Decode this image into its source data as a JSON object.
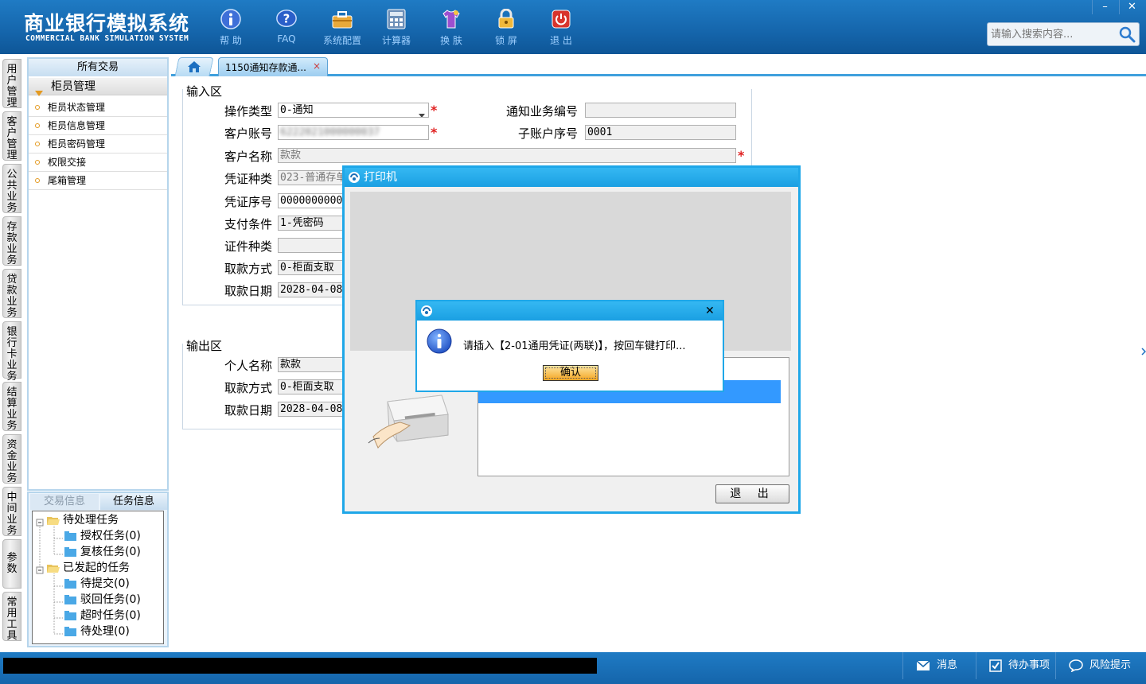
{
  "app": {
    "title": "商业银行模拟系统",
    "subtitle": "COMMERCIAL BANK SIMULATION SYSTEM"
  },
  "toolbar": {
    "help": "帮 助",
    "faq": "FAQ",
    "settings": "系统配置",
    "calculator": "计算器",
    "skin": "换 肤",
    "lock": "锁 屏",
    "exit": "退 出"
  },
  "window_controls": {
    "minimize": "–",
    "close": "✕"
  },
  "search": {
    "placeholder": "请输入搜索内容..."
  },
  "vtabs": [
    "用户管理",
    "客户管理",
    "公共业务",
    "存款业务",
    "贷款业务",
    "银行卡业务",
    "结算业务",
    "资金业务",
    "中间业务",
    "参数",
    "常用工具"
  ],
  "sidebar": {
    "title": "所有交易",
    "group": "柜员管理",
    "items": [
      "柜员状态管理",
      "柜员信息管理",
      "柜员密码管理",
      "权限交接",
      "尾箱管理"
    ]
  },
  "taskpanel": {
    "tabs": [
      "交易信息",
      "任务信息"
    ],
    "tree": {
      "pending": "待处理任务",
      "auth": "授权任务(0)",
      "review": "复核任务(0)",
      "initiated": "已发起的任务",
      "to_submit": "待提交(0)",
      "rejected": "驳回任务(0)",
      "timeout": "超时任务(0)",
      "to_process": "待处理(0)"
    }
  },
  "tabs": {
    "doc": "1150通知存款通...",
    "doc_close": "×"
  },
  "input_section": {
    "label": "输入区",
    "op_type_label": "操作类型",
    "op_type_value": "0-通知",
    "notice_no_label": "通知业务编号",
    "notice_no_value": "",
    "account_label": "客户账号",
    "account_value": "6222021000000037",
    "sub_account_label": "子账户序号",
    "sub_account_value": "0001",
    "cust_name_label": "客户名称",
    "cust_name_value": "款款",
    "voucher_type_label": "凭证种类",
    "voucher_type_value": "023-普通存单",
    "voucher_no_label": "凭证序号",
    "voucher_no_value": "00000000000",
    "pay_cond_label": "支付条件",
    "pay_cond_value": "1-凭密码",
    "id_type_label": "证件种类",
    "id_type_value": "",
    "withdraw_label": "取款方式",
    "withdraw_value": "0-柜面支取",
    "date_label": "取款日期",
    "date_value": "2028-04-08"
  },
  "output_section": {
    "label": "输出区",
    "name_label": "个人名称",
    "name_value": "款款",
    "withdraw_label": "取款方式",
    "withdraw_value": "0-柜面支取",
    "date_label": "取款日期",
    "date_value": "2028-04-08"
  },
  "printer_dialog": {
    "title": "打印机",
    "exit_label": "退 出"
  },
  "message_dialog": {
    "text": "请插入【2-01通用凭证(两联)】，按回车键打印...",
    "ok_label": "确认",
    "close": "✕"
  },
  "statusbar": {
    "messages": "消息",
    "todo": "待办事项",
    "risk": "风险提示"
  },
  "colors": {
    "header": "#1565ab",
    "accent": "#1fa7e8",
    "required": "#e02020"
  }
}
